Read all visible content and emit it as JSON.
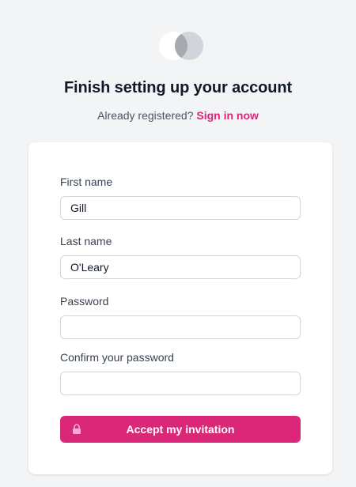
{
  "header": {
    "logo_icon": "overlapping-circles-logo",
    "title": "Finish setting up your account",
    "subtitle_text": "Already registered?",
    "signin_link": "Sign in now"
  },
  "form": {
    "first_name": {
      "label": "First name",
      "value": "Gill"
    },
    "last_name": {
      "label": "Last name",
      "value": "O'Leary"
    },
    "password": {
      "label": "Password",
      "value": ""
    },
    "confirm_password": {
      "label": "Confirm your password",
      "value": ""
    },
    "submit": {
      "label": "Accept my invitation",
      "icon": "lock-icon"
    }
  },
  "colors": {
    "background": "#f3f4f6",
    "accent": "#db2777",
    "card": "#ffffff"
  }
}
